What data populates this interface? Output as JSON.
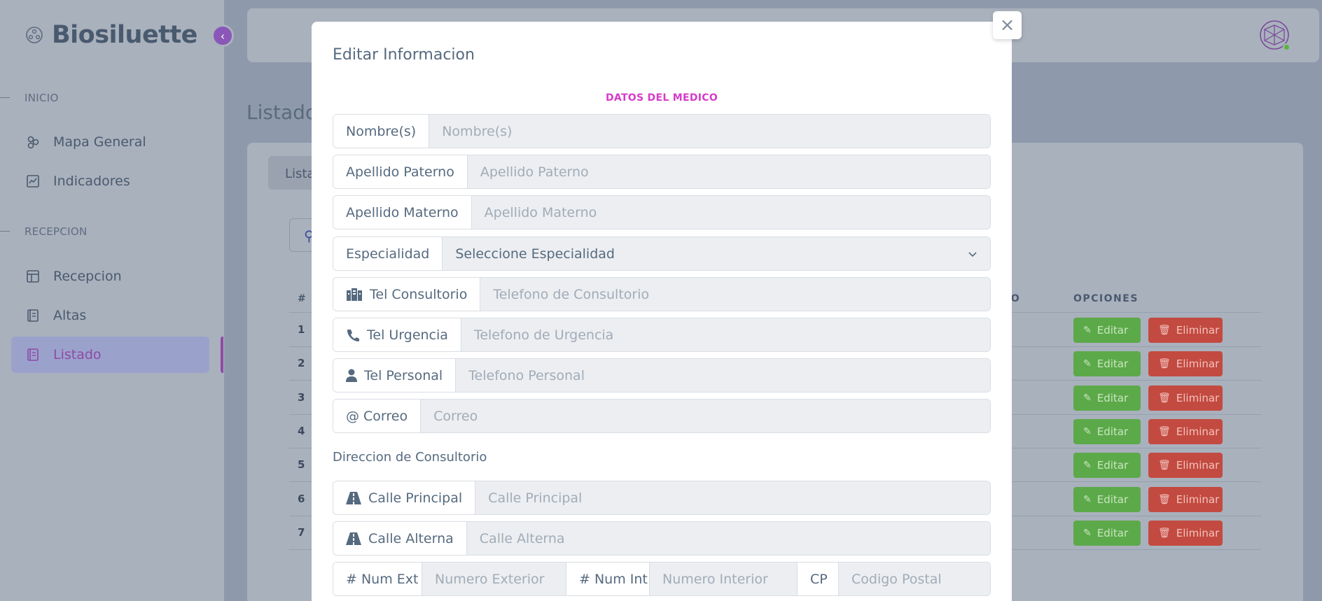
{
  "sidebar": {
    "brand": "Biosiluette",
    "sections": [
      {
        "header": "INICIO",
        "items": [
          {
            "label": "Mapa General",
            "icon": "nodes-icon"
          },
          {
            "label": "Indicadores",
            "icon": "chart-icon"
          }
        ]
      },
      {
        "header": "RECEPCION",
        "items": [
          {
            "label": "Recepcion",
            "icon": "layout-icon"
          },
          {
            "label": "Altas",
            "icon": "book-icon"
          },
          {
            "label": "Listado",
            "icon": "list-book-icon",
            "active": true
          }
        ]
      }
    ]
  },
  "background": {
    "page_title": "Listado",
    "tab_label": "Lista",
    "table": {
      "headers": {
        "num": "#",
        "col_partial": "IO",
        "options": "OPCIONES"
      },
      "rows": [
        "1",
        "2",
        "3",
        "4",
        "5",
        "6",
        "7"
      ],
      "edit_label": "Editar",
      "delete_label": "Eliminar"
    }
  },
  "modal": {
    "title": "Editar Informacion",
    "close_symbol": "×",
    "section_title": "DATOS DEL MEDICO",
    "fields": {
      "nombre": {
        "label": "Nombre(s)",
        "placeholder": "Nombre(s)"
      },
      "apellido_paterno": {
        "label": "Apellido Paterno",
        "placeholder": "Apellido Paterno"
      },
      "apellido_materno": {
        "label": "Apellido Materno",
        "placeholder": "Apellido Materno"
      },
      "especialidad": {
        "label": "Especialidad",
        "value": "Seleccione Especialidad"
      },
      "tel_consultorio": {
        "label": "Tel Consultorio",
        "placeholder": "Telefono de Consultorio"
      },
      "tel_urgencia": {
        "label": "Tel Urgencia",
        "placeholder": "Telefono de Urgencia"
      },
      "tel_personal": {
        "label": "Tel Personal",
        "placeholder": "Telefono Personal"
      },
      "correo": {
        "label": "@ Correo",
        "placeholder": "Correo"
      }
    },
    "address_title": "Direccion de Consultorio",
    "address": {
      "calle_principal": {
        "label": "Calle Principal",
        "placeholder": "Calle Principal"
      },
      "calle_alterna": {
        "label": "Calle Alterna",
        "placeholder": "Calle Alterna"
      },
      "num_ext": {
        "label": "# Num Ext",
        "placeholder": "Numero Exterior"
      },
      "num_int": {
        "label": "# Num Int",
        "placeholder": "Numero Interior"
      },
      "cp": {
        "label": "CP",
        "placeholder": "Codigo Postal"
      }
    }
  },
  "colors": {
    "accent": "#8f4aa6",
    "success": "#71dd37",
    "danger": "#ff3e1d",
    "section_title": "#e83e8c"
  }
}
